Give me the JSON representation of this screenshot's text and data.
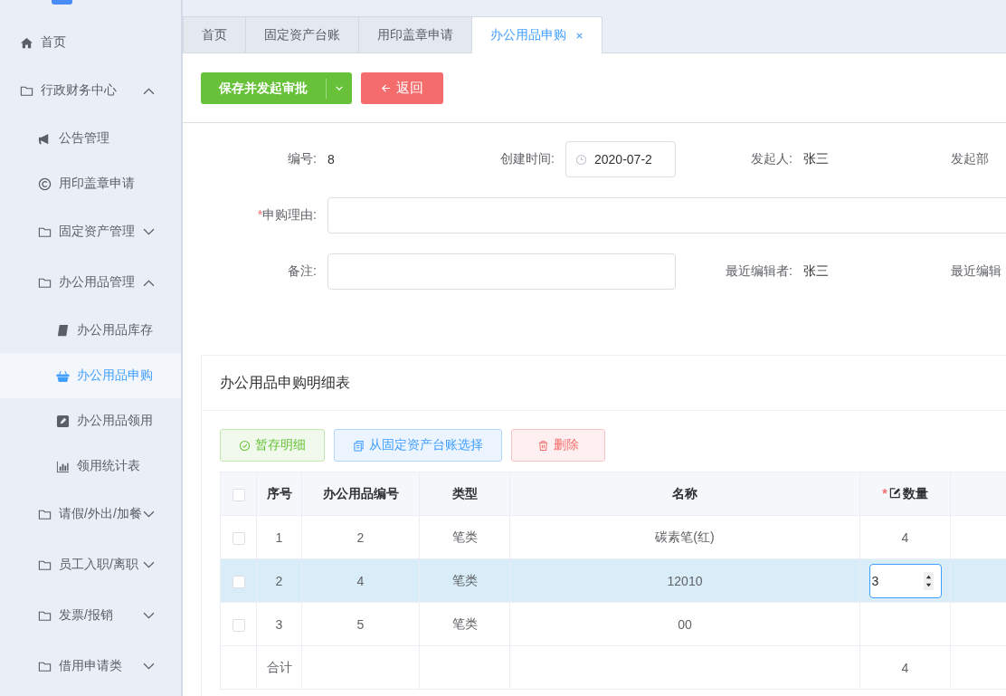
{
  "sidebar": {
    "items": [
      {
        "label": "首页",
        "selected": false
      },
      {
        "label": "行政财务中心",
        "expanded": true,
        "children": [
          {
            "label": "公告管理",
            "selected": false
          },
          {
            "label": "用印盖章申请",
            "selected": false
          },
          {
            "label": "固定资产管理",
            "expanded": false
          },
          {
            "label": "办公用品管理",
            "expanded": true,
            "children": [
              {
                "label": "办公用品库存",
                "selected": false
              },
              {
                "label": "办公用品申购",
                "selected": true
              },
              {
                "label": "办公用品领用",
                "selected": false
              },
              {
                "label": "领用统计表",
                "selected": false
              }
            ]
          },
          {
            "label": "请假/外出/加餐",
            "expanded": false
          },
          {
            "label": "员工入职/离职",
            "expanded": false
          },
          {
            "label": "发票/报销",
            "expanded": false
          },
          {
            "label": "借用申请类",
            "expanded": false
          }
        ]
      }
    ]
  },
  "tabs": [
    {
      "label": "首页",
      "selected": false
    },
    {
      "label": "固定资产台账",
      "selected": false
    },
    {
      "label": "用印盖章申请",
      "selected": false
    },
    {
      "label": "办公用品申购",
      "selected": true
    }
  ],
  "toolbar": {
    "submit": "保存并发起审批",
    "back": "返回"
  },
  "form": {
    "fields": [
      {
        "label": "编号:",
        "value": "8",
        "kind": "text"
      },
      {
        "label": "创建时间:",
        "value": "2020-07-2",
        "kind": "date"
      },
      {
        "label": "发起人:",
        "value": "张三",
        "kind": "text"
      },
      {
        "label": "发起部",
        "kind": "text"
      },
      {
        "label": "申购理由:",
        "kind": "wide-input",
        "required_mark": "*"
      },
      {
        "label": "备注:",
        "kind": "input"
      },
      {
        "label": "最近编辑者:",
        "value": "张三",
        "kind": "text"
      },
      {
        "label": "最近编辑",
        "kind": "text"
      }
    ]
  },
  "detail": {
    "title": "办公用品申购明细表",
    "buttons": [
      {
        "label": "暂存明细",
        "kind": "success"
      },
      {
        "label": "从固定资产台账选择",
        "kind": "primary"
      },
      {
        "label": "删除",
        "kind": "danger"
      }
    ],
    "table": {
      "all_checked": false,
      "columns": [
        {
          "label": "序号",
          "editable": false
        },
        {
          "label": "办公用品编号",
          "editable": false
        },
        {
          "label": "类型",
          "editable": false
        },
        {
          "label": "名称",
          "editable": false
        },
        {
          "label": "数量",
          "required_mark": "*",
          "editable": true
        }
      ],
      "rows": [
        {
          "checked": false,
          "selected": false,
          "editing": false,
          "cells": [
            "1",
            "2",
            "笔类",
            "碳素笔(红)",
            "4"
          ]
        },
        {
          "checked": false,
          "selected": true,
          "editing": true,
          "cells": [
            "2",
            "4",
            "笔类",
            "12010",
            "3"
          ]
        },
        {
          "checked": false,
          "selected": false,
          "editing": false,
          "cells": [
            "3",
            "5",
            "笔类",
            "00",
            ""
          ]
        }
      ],
      "total": {
        "label": "合计",
        "quantity": "4"
      }
    }
  }
}
